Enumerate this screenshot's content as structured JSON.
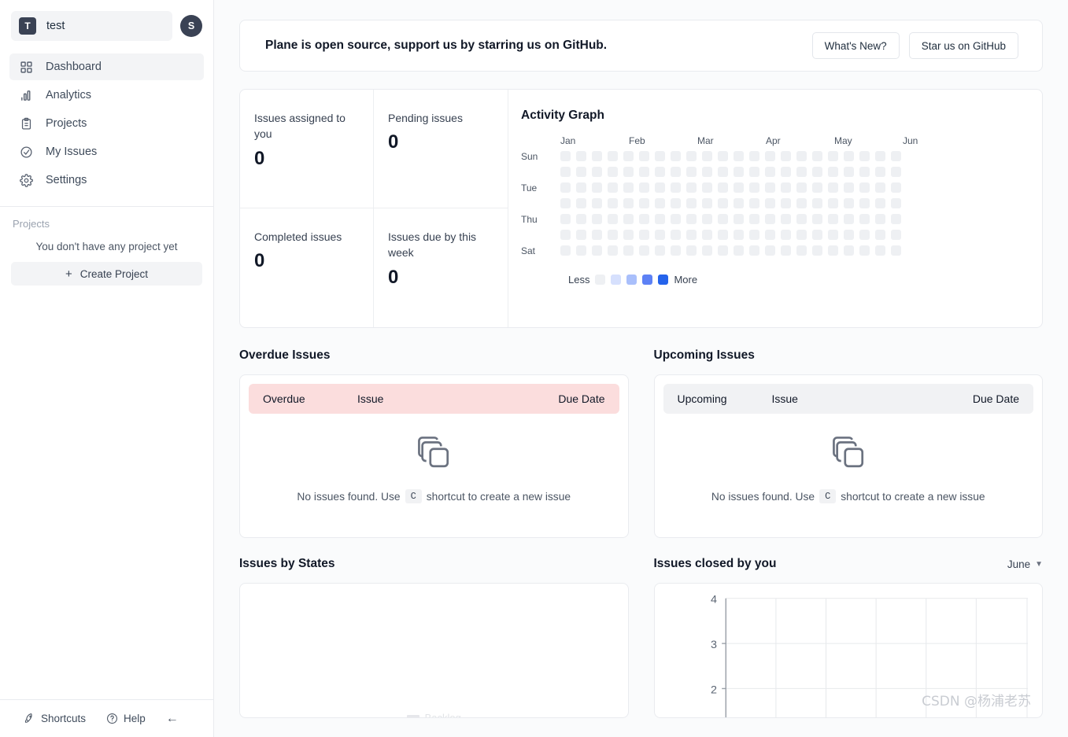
{
  "sidebar": {
    "workspace": {
      "initial": "T",
      "name": "test"
    },
    "avatar": {
      "initial": "S"
    },
    "nav_items": [
      {
        "label": "Dashboard",
        "icon": "grid-icon",
        "active": true
      },
      {
        "label": "Analytics",
        "icon": "bar-chart-icon",
        "active": false
      },
      {
        "label": "Projects",
        "icon": "clipboard-icon",
        "active": false
      },
      {
        "label": "My Issues",
        "icon": "check-circle-icon",
        "active": false
      },
      {
        "label": "Settings",
        "icon": "gear-icon",
        "active": false
      }
    ],
    "projects": {
      "heading": "Projects",
      "empty_text": "You don't have any project yet",
      "create_label": "Create Project",
      "create_icon": "plus-icon"
    },
    "footer": {
      "shortcuts_label": "Shortcuts",
      "shortcuts_icon": "rocket-icon",
      "help_label": "Help",
      "help_icon": "question-circle-icon",
      "collapse_icon": "arrow-left-icon"
    }
  },
  "banner": {
    "message": "Plane is open source, support us by starring us on GitHub.",
    "whats_new_label": "What's New?",
    "star_label": "Star us on GitHub"
  },
  "stats": [
    {
      "label": "Issues assigned to you",
      "value": "0"
    },
    {
      "label": "Pending issues",
      "value": "0"
    },
    {
      "label": "Completed issues",
      "value": "0"
    },
    {
      "label": "Issues due by this week",
      "value": "0"
    }
  ],
  "activity_graph": {
    "title": "Activity Graph",
    "months": [
      "Jan",
      "Feb",
      "Mar",
      "Apr",
      "May",
      "Jun"
    ],
    "day_labels": [
      "Sun",
      "",
      "Tue",
      "",
      "Thu",
      "",
      "Sat"
    ],
    "columns": 22,
    "rows": 7,
    "empty_color": "#eef0f3",
    "legend": {
      "less_label": "Less",
      "more_label": "More",
      "colors": [
        "#eef0f3",
        "#d6e0fd",
        "#a9bffb",
        "#5d81f5",
        "#2563eb"
      ]
    }
  },
  "overdue": {
    "title": "Overdue Issues",
    "columns": [
      "Overdue",
      "Issue",
      "Due Date"
    ],
    "header_color": "#fbdddd",
    "empty_message_before": "No issues found. Use",
    "empty_key": "C",
    "empty_message_after": "shortcut to create a new issue",
    "empty_icon": "stacked-layers-icon"
  },
  "upcoming": {
    "title": "Upcoming Issues",
    "columns": [
      "Upcoming",
      "Issue",
      "Due Date"
    ],
    "header_color": "#f1f2f4",
    "empty_message_before": "No issues found. Use",
    "empty_key": "C",
    "empty_message_after": "shortcut to create a new issue",
    "empty_icon": "stacked-layers-icon"
  },
  "issues_by_states": {
    "title": "Issues by States",
    "legend_label": "Backlog"
  },
  "issues_closed": {
    "title": "Issues closed by you",
    "month_value": "June",
    "month_icon": "chevron-down-icon"
  },
  "watermark": "CSDN @杨浦老苏",
  "chart_data": [
    {
      "type": "pie",
      "title": "Issues by States",
      "categories": [
        "Backlog"
      ],
      "values": [
        0
      ],
      "legend_position": "bottom"
    },
    {
      "type": "line",
      "title": "Issues closed by you",
      "x": [],
      "values": [],
      "ylabel": "",
      "xlabel": "",
      "yticks": [
        4,
        3,
        2
      ],
      "ylim": [
        2,
        4
      ],
      "grid": true,
      "x_gridlines": 6,
      "legend_position": "none"
    }
  ]
}
